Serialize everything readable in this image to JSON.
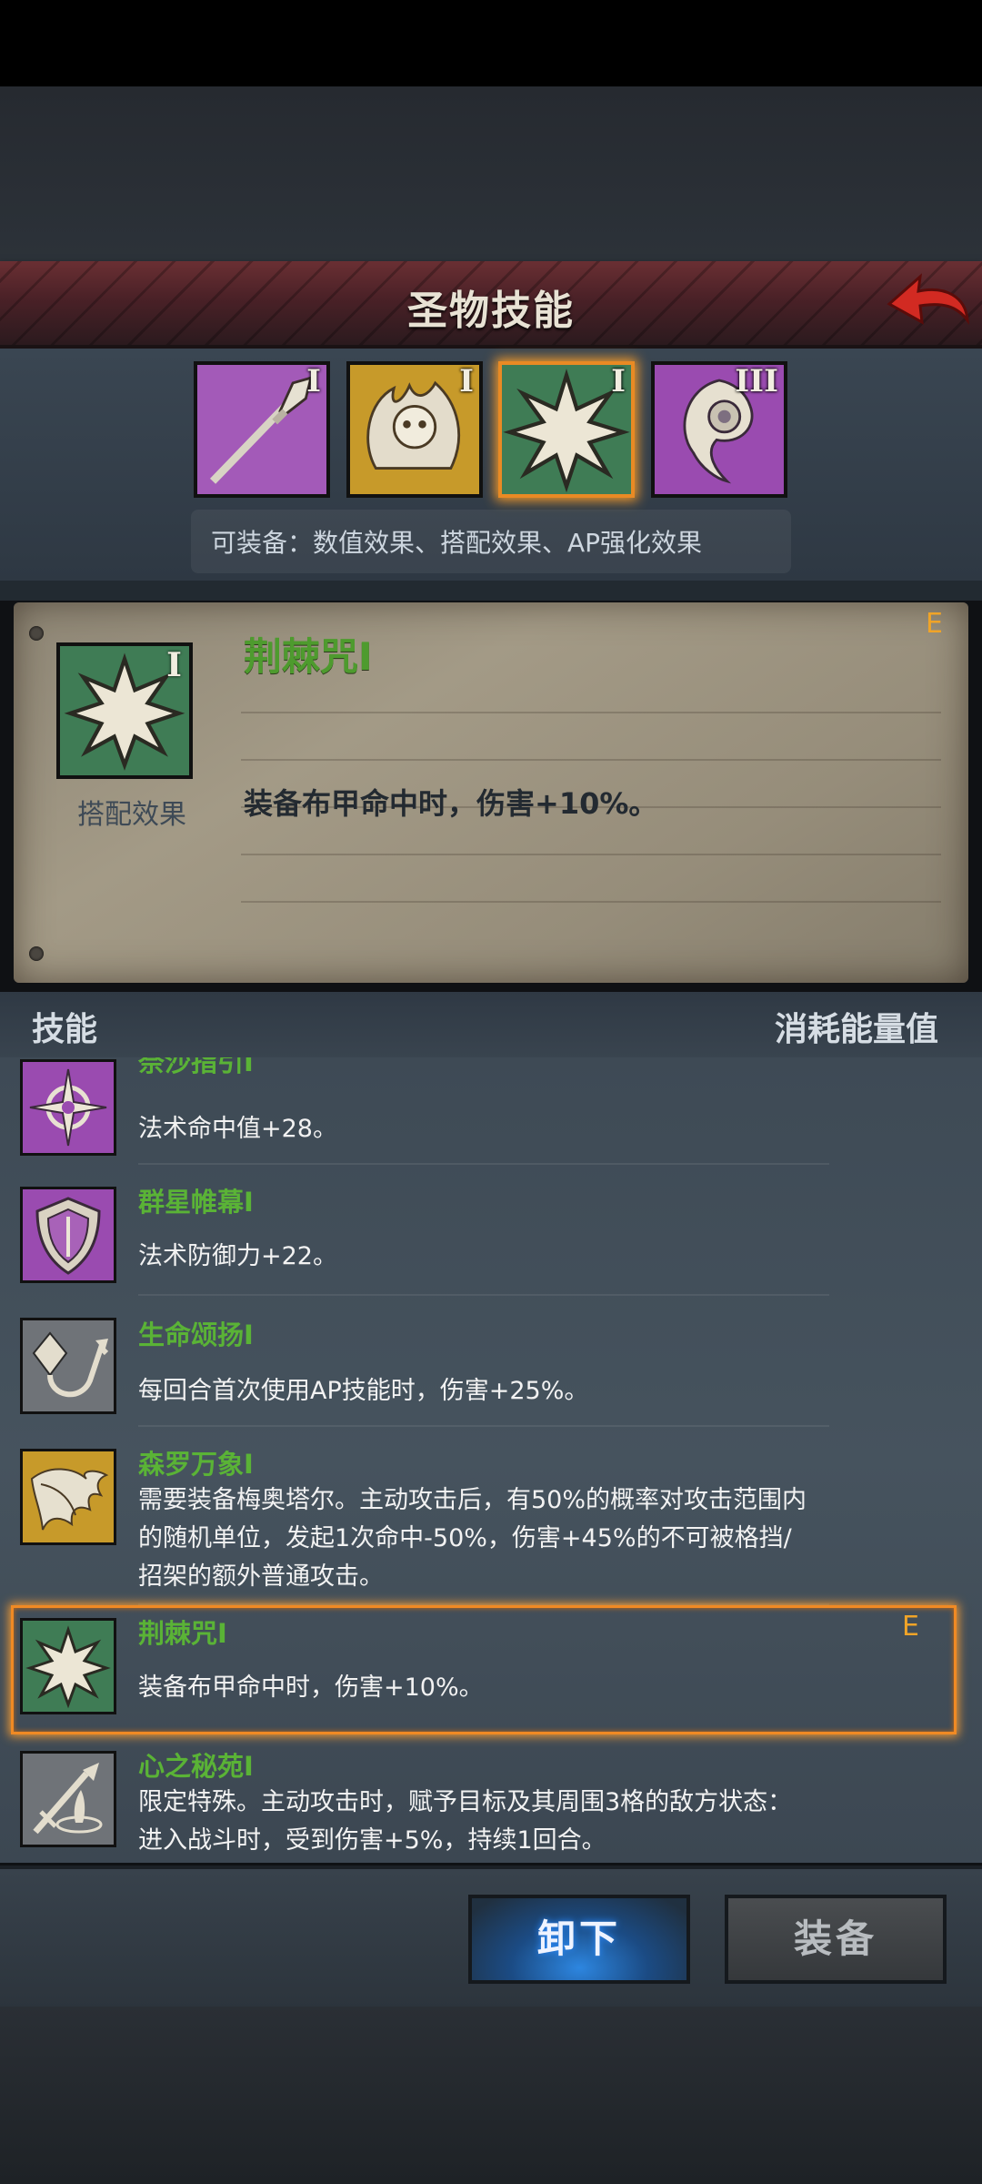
{
  "header": {
    "title": "圣物技能",
    "back_icon": "back-arrow-icon",
    "accent": "#c8342b"
  },
  "relic_slots": [
    {
      "icon": "spear-icon",
      "roman": "I",
      "color": "#a35ab8",
      "selected": false
    },
    {
      "icon": "skull-flame-icon",
      "roman": "I",
      "color": "#c79a2a",
      "selected": false
    },
    {
      "icon": "starburst-icon",
      "roman": "I",
      "color": "#3f7c55",
      "selected": true
    },
    {
      "icon": "swirl-orb-icon",
      "roman": "III",
      "color": "#9a4bb0",
      "selected": false
    }
  ],
  "equip_note": "可装备：数值效果、搭配效果、AP强化效果",
  "detail": {
    "name": "荆棘咒I",
    "type": "搭配效果",
    "description": "装备布甲命中时，伤害+10%。",
    "grade": "E",
    "roman": "I",
    "icon": "starburst-icon"
  },
  "columns": {
    "skill": "技能",
    "cost": "消耗能量值"
  },
  "skills": [
    {
      "name": "奈沙指引I",
      "description": "法术命中值+28。",
      "icon": "compass-star-icon",
      "color": "#9a4bb0",
      "grade": ""
    },
    {
      "name": "群星帷幕I",
      "description": "法术防御力+22。",
      "icon": "shield-icon",
      "color": "#9a4bb0",
      "grade": ""
    },
    {
      "name": "生命颂扬I",
      "description": "每回合首次使用AP技能时，伤害+25%。",
      "icon": "crystal-hook-icon",
      "color": "#6f7378",
      "grade": ""
    },
    {
      "name": "森罗万象I",
      "description": "需要装备梅奥塔尔。主动攻击后，有50%的概率对攻击范围内的随机单位，发起1次命中-50%，伤害+45%的不可被格挡/招架的额外普通攻击。",
      "icon": "dragon-wing-icon",
      "color": "#c79a2a",
      "grade": ""
    },
    {
      "name": "荆棘咒I",
      "description": "装备布甲命中时，伤害+10%。",
      "icon": "starburst-icon",
      "color": "#3f7c55",
      "grade": "E",
      "selected": true
    },
    {
      "name": "心之秘苑I",
      "description": "限定特殊。主动攻击时，赋予目标及其周围3格的敌方状态：进入战斗时，受到伤害+5%，持续1回合。",
      "icon": "sword-fountain-icon",
      "color": "#6f7378",
      "grade": ""
    }
  ],
  "buttons": {
    "unequip": "卸下",
    "equip": "装备"
  }
}
